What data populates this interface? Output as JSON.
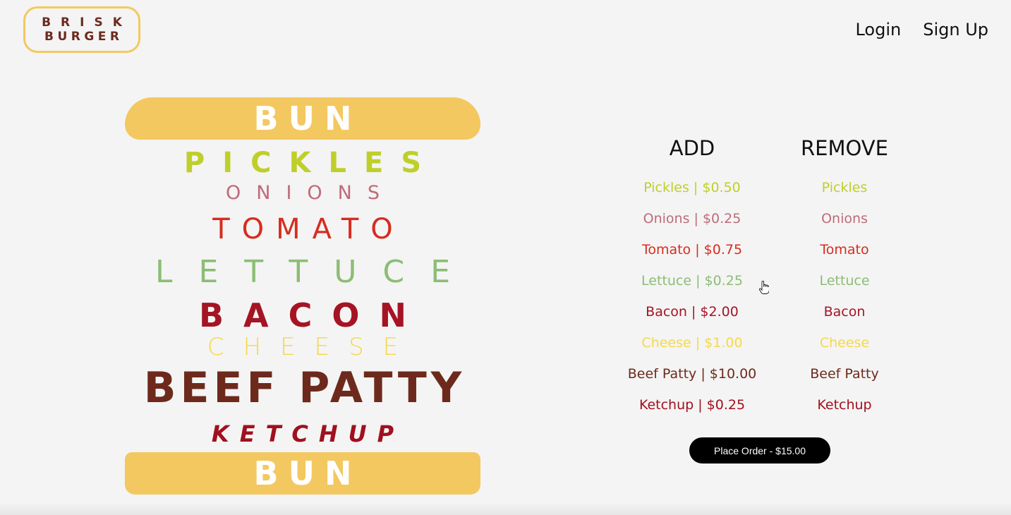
{
  "header": {
    "logo": {
      "line1": "BRISK",
      "line2": "BURGER"
    },
    "nav": {
      "login": "Login",
      "signup": "Sign Up"
    }
  },
  "burger": {
    "top_bun": "BUN",
    "layers": [
      "PICKLES",
      "ONIONS",
      "TOMATO",
      "LETTUCE",
      "BACON",
      "CHEESE",
      "BEEF PATTY",
      "KETCHUP"
    ],
    "bottom_bun": "BUN"
  },
  "add": {
    "title": "ADD",
    "items": [
      {
        "label": "Pickles | $0.50",
        "color": "#bfcf2a"
      },
      {
        "label": "Onions | $0.25",
        "color": "#bf6b78"
      },
      {
        "label": "Tomato | $0.75",
        "color": "#d62d1f"
      },
      {
        "label": "Lettuce | $0.25",
        "color": "#8cbd74"
      },
      {
        "label": "Bacon | $2.00",
        "color": "#a51424"
      },
      {
        "label": "Cheese | $1.00",
        "color": "#f5d84a"
      },
      {
        "label": "Beef Patty | $10.00",
        "color": "#6d2a1c"
      },
      {
        "label": "Ketchup | $0.25",
        "color": "#a0101e"
      }
    ]
  },
  "remove": {
    "title": "REMOVE",
    "items": [
      {
        "label": "Pickles",
        "color": "#bfcf2a"
      },
      {
        "label": "Onions",
        "color": "#bf6b78"
      },
      {
        "label": "Tomato",
        "color": "#d62d1f"
      },
      {
        "label": "Lettuce",
        "color": "#8cbd74"
      },
      {
        "label": "Bacon",
        "color": "#a51424"
      },
      {
        "label": "Cheese",
        "color": "#f5d84a"
      },
      {
        "label": "Beef Patty",
        "color": "#6d2a1c"
      },
      {
        "label": "Ketchup",
        "color": "#a0101e"
      }
    ]
  },
  "order": {
    "label": "Place Order - $15.00"
  },
  "colors": {
    "bun": "#f4c860",
    "logo_border": "#f3c95f",
    "logo_text": "#6b2a1d",
    "background": "#f4f4f4"
  }
}
